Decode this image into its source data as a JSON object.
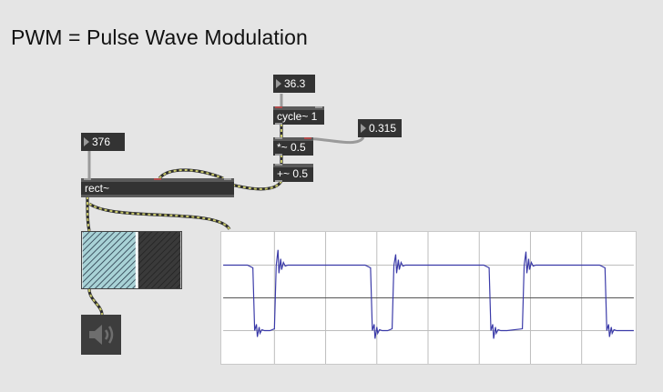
{
  "title": "PWM = Pulse Wave Modulation",
  "number_boxes": {
    "frequency": "376",
    "lfo_rate": "36.3",
    "depth": "0.315"
  },
  "objects": {
    "rect": "rect~",
    "cycle": "cycle~ 1",
    "multiply": "*~ 0.5",
    "add": "+~ 0.5"
  },
  "colors": {
    "background": "#e5e5e5",
    "object_fill": "#333333",
    "patch_cord_signal": "#c8c86a",
    "patch_cord_control": "#9a9a9a",
    "scope_trace": "#3a3aa8",
    "meter_fill": "#a8d2d6"
  },
  "icons": {
    "speaker": "speaker-icon",
    "number_triangle": "triangle-icon"
  }
}
